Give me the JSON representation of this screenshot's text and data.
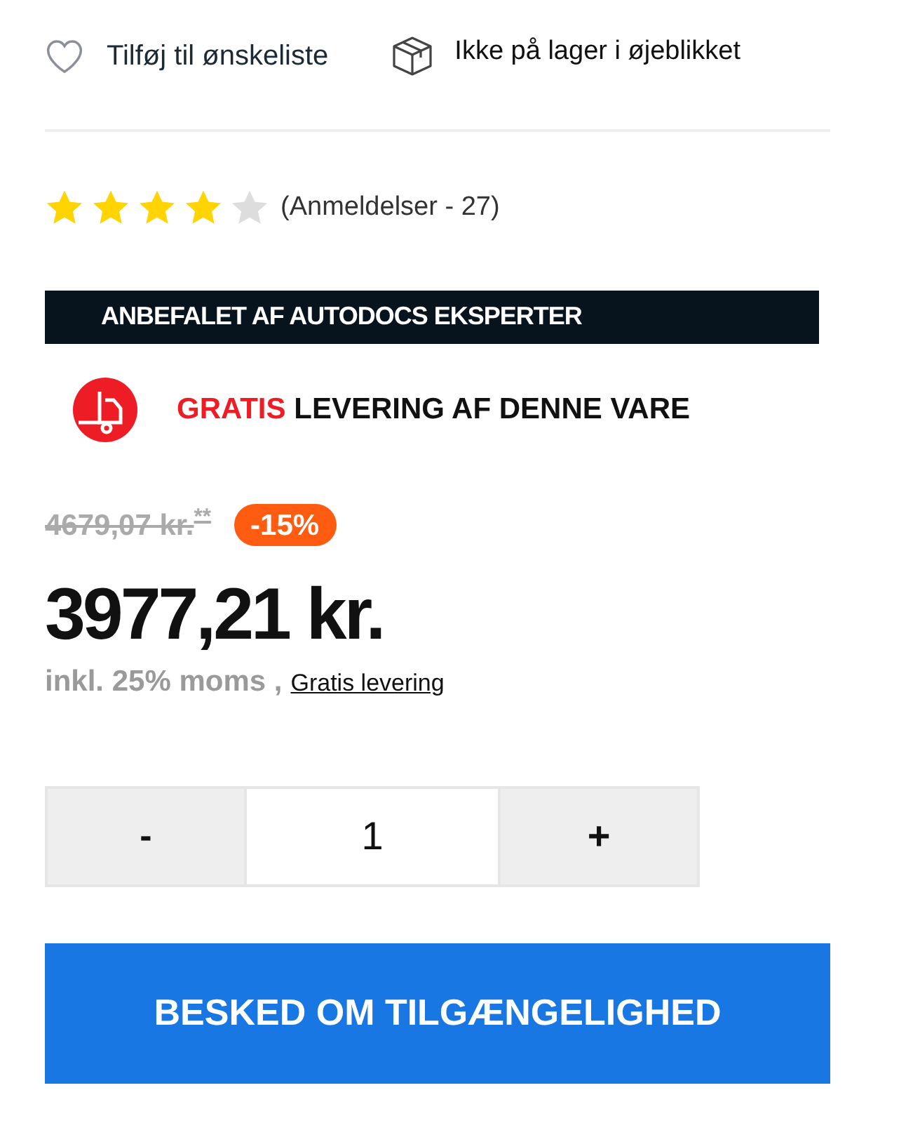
{
  "actions": {
    "wishlist": "Tilføj til ønskeliste",
    "stock": "Ikke på lager i øjeblikket"
  },
  "rating": {
    "stars": 4,
    "reviews": "(Anmeldelser - 27)"
  },
  "recommended_banner": "ANBEFALET AF AUTODOCS EKSPERTER",
  "delivery": {
    "highlight": "GRATIS",
    "text": "LEVERING AF DENNE VARE"
  },
  "price": {
    "old": "4679,07 kr.$^{**}$",
    "discount": "-15%",
    "current": "3977,21 kr.",
    "vat_note": "inkl. 25% moms ,",
    "shipping_link": "Gratis levering"
  },
  "quantity": {
    "decrement": "-",
    "value": "1",
    "increment": "+"
  },
  "notify_button": "BESKED OM TILGÆNGELIGHED"
}
